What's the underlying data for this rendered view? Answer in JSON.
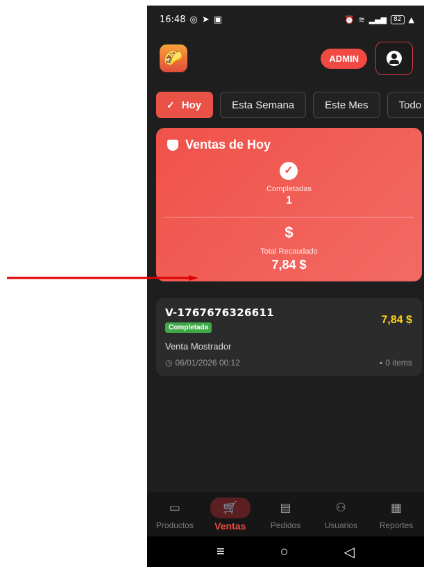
{
  "caption": "16:48 — Ventas de Hoy",
  "status_bar": {
    "time": "16:48",
    "battery": "82"
  },
  "header": {
    "admin_label": "ADMIN"
  },
  "filters": [
    {
      "label": "Hoy",
      "active": true
    },
    {
      "label": "Esta Semana",
      "active": false
    },
    {
      "label": "Este Mes",
      "active": false
    },
    {
      "label": "Todo",
      "active": false
    }
  ],
  "summary": {
    "title": "Ventas de Hoy",
    "completed_label": "Completadas",
    "completed_value": "1",
    "total_label": "Total Recaudado",
    "total_value": "7,84 $"
  },
  "sale": {
    "id": "V-1767676326611",
    "status": "Completada",
    "amount": "7,84 $",
    "description": "Venta Mostrador",
    "date": "06/01/2026 00:12",
    "items": "0 items"
  },
  "bottom_nav": [
    {
      "label": "Productos",
      "icon": "archive-icon",
      "active": false
    },
    {
      "label": "Ventas",
      "icon": "cart-icon",
      "active": true
    },
    {
      "label": "Pedidos",
      "icon": "receipt-icon",
      "active": false
    },
    {
      "label": "Usuarios",
      "icon": "users-icon",
      "active": false
    },
    {
      "label": "Reportes",
      "icon": "report-icon",
      "active": false
    }
  ],
  "colors": {
    "accent": "#f04a43",
    "amount": "#ffd21a",
    "status_green": "#3fa949",
    "arrow": "#e00000"
  }
}
